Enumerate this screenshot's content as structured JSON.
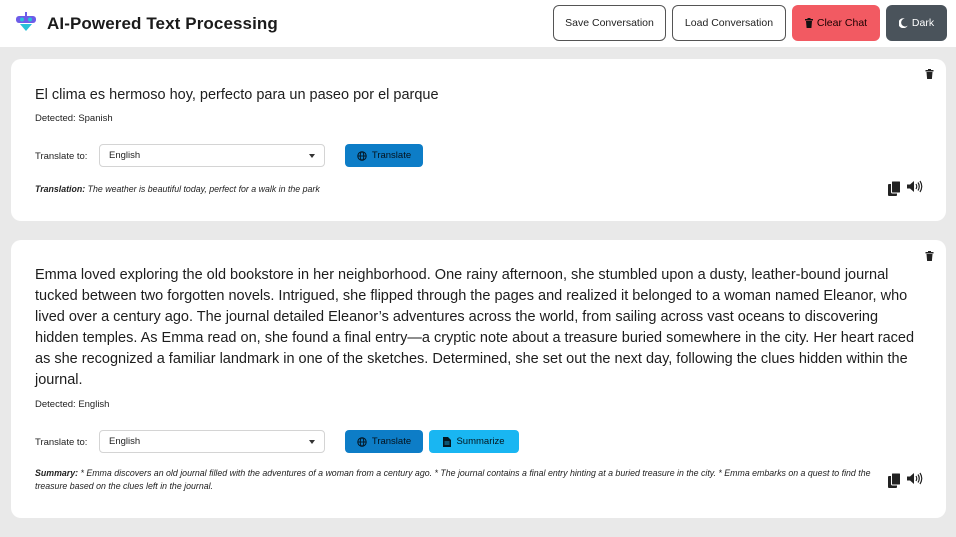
{
  "header": {
    "title": "AI-Powered Text Processing",
    "save_label": "Save Conversation",
    "load_label": "Load Conversation",
    "clear_label": "Clear Chat",
    "theme_label": "Dark"
  },
  "messages": [
    {
      "text": "El clima es hermoso hoy, perfecto para un paseo por el parque",
      "detected_label": "Detected:",
      "detected_language": "Spanish",
      "translate_to_label": "Translate to:",
      "selected_language": "English",
      "translate_button": "Translate",
      "result_label": "Translation:",
      "result_text": "The weather is beautiful today, perfect for a walk in the park"
    },
    {
      "text": "Emma loved exploring the old bookstore in her neighborhood. One rainy afternoon, she stumbled upon a dusty, leather-bound journal tucked between two forgotten novels. Intrigued, she flipped through the pages and realized it belonged to a woman named Eleanor, who lived over a century ago. The journal detailed Eleanor’s adventures across the world, from sailing across vast oceans to discovering hidden temples. As Emma read on, she found a final entry—a cryptic note about a treasure buried somewhere in the city. Her heart raced as she recognized a familiar landmark in one of the sketches. Determined, she set out the next day, following the clues hidden within the journal.",
      "detected_label": "Detected:",
      "detected_language": "English",
      "translate_to_label": "Translate to:",
      "selected_language": "English",
      "translate_button": "Translate",
      "summarize_button": "Summarize",
      "result_label": "Summary:",
      "result_text": "* Emma discovers an old journal filled with the adventures of a woman from a century ago. * The journal contains a final entry hinting at a buried treasure in the city. * Emma embarks on a quest to find the treasure based on the clues left in the journal."
    }
  ],
  "icons": {
    "logo": "robot-logo-icon",
    "clear": "trash-icon",
    "theme": "moon-icon",
    "delete": "trash-icon",
    "translate": "globe-icon",
    "summarize": "document-icon",
    "copy": "copy-icon",
    "speak": "speaker-icon"
  },
  "colors": {
    "clear_button": "#f25a62",
    "dark_button": "#4a535b",
    "translate_button": "#0d7dc7",
    "summarize_button": "#19b6f2",
    "logo_primary": "#6d5ce8",
    "logo_accent": "#27c2d8"
  }
}
